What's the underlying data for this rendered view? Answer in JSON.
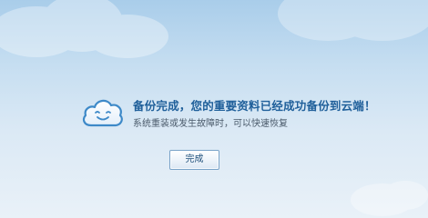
{
  "message": {
    "title": "备份完成，您的重要资料已经成功备份到云端！",
    "subtitle": "系统重装或发生故障时，可以快速恢复"
  },
  "actions": {
    "done_label": "完成"
  },
  "icons": {
    "logo": "smiling-cloud-icon"
  },
  "colors": {
    "title": "#1f5f9a",
    "subtitle": "#4a5a6a",
    "background_top": "#a9cdea",
    "background_bottom": "#e9f1f8"
  }
}
